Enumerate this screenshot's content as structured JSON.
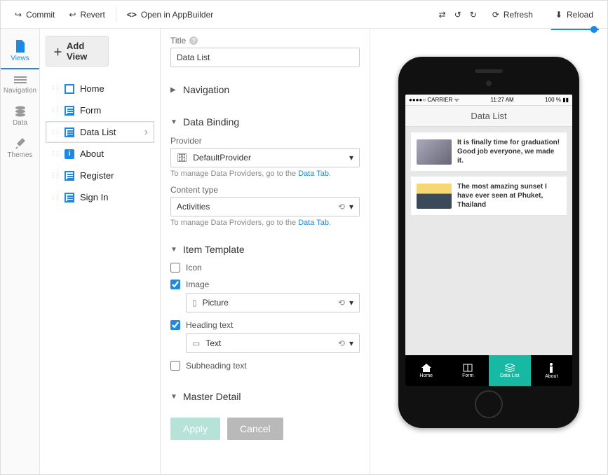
{
  "topbar": {
    "commit": "Commit",
    "revert": "Revert",
    "open": "Open in AppBuilder",
    "refresh": "Refresh",
    "reload": "Reload"
  },
  "rail": {
    "views": "Views",
    "navigation": "Navigation",
    "data": "Data",
    "themes": "Themes"
  },
  "addView": "Add View",
  "views": {
    "home": "Home",
    "form": "Form",
    "dataList": "Data List",
    "about": "About",
    "register": "Register",
    "signIn": "Sign In"
  },
  "props": {
    "titleLabel": "Title",
    "titleValue": "Data List",
    "navSection": "Navigation",
    "dataBindingSection": "Data Binding",
    "providerLabel": "Provider",
    "providerValue": "DefaultProvider",
    "providerHint": "To manage Data Providers, go to the ",
    "providerHintLink": "Data Tab",
    "contentTypeLabel": "Content type",
    "contentTypeValue": "Activities",
    "contentTypeHint": "To manage Data Providers, go to the ",
    "contentTypeHintLink": "Data Tab",
    "itemTemplateSection": "Item Template",
    "iconLabel": "Icon",
    "imageLabel": "Image",
    "imageValue": "Picture",
    "headingLabel": "Heading text",
    "headingValue": "Text",
    "subheadingLabel": "Subheading text",
    "masterDetailSection": "Master Detail",
    "applyBtn": "Apply",
    "cancelBtn": "Cancel"
  },
  "preview": {
    "carrier": "●●●●○ CARRIER",
    "time": "11:27 AM",
    "battery": "100 %",
    "title": "Data List",
    "item1": "It is finally time for graduation! Good job everyone, we made it.",
    "item2": "The most amazing sunset I have ever seen at Phuket, Thailand",
    "tabs": {
      "home": "Home",
      "form": "Form",
      "dataList": "Data List",
      "about": "About"
    }
  }
}
